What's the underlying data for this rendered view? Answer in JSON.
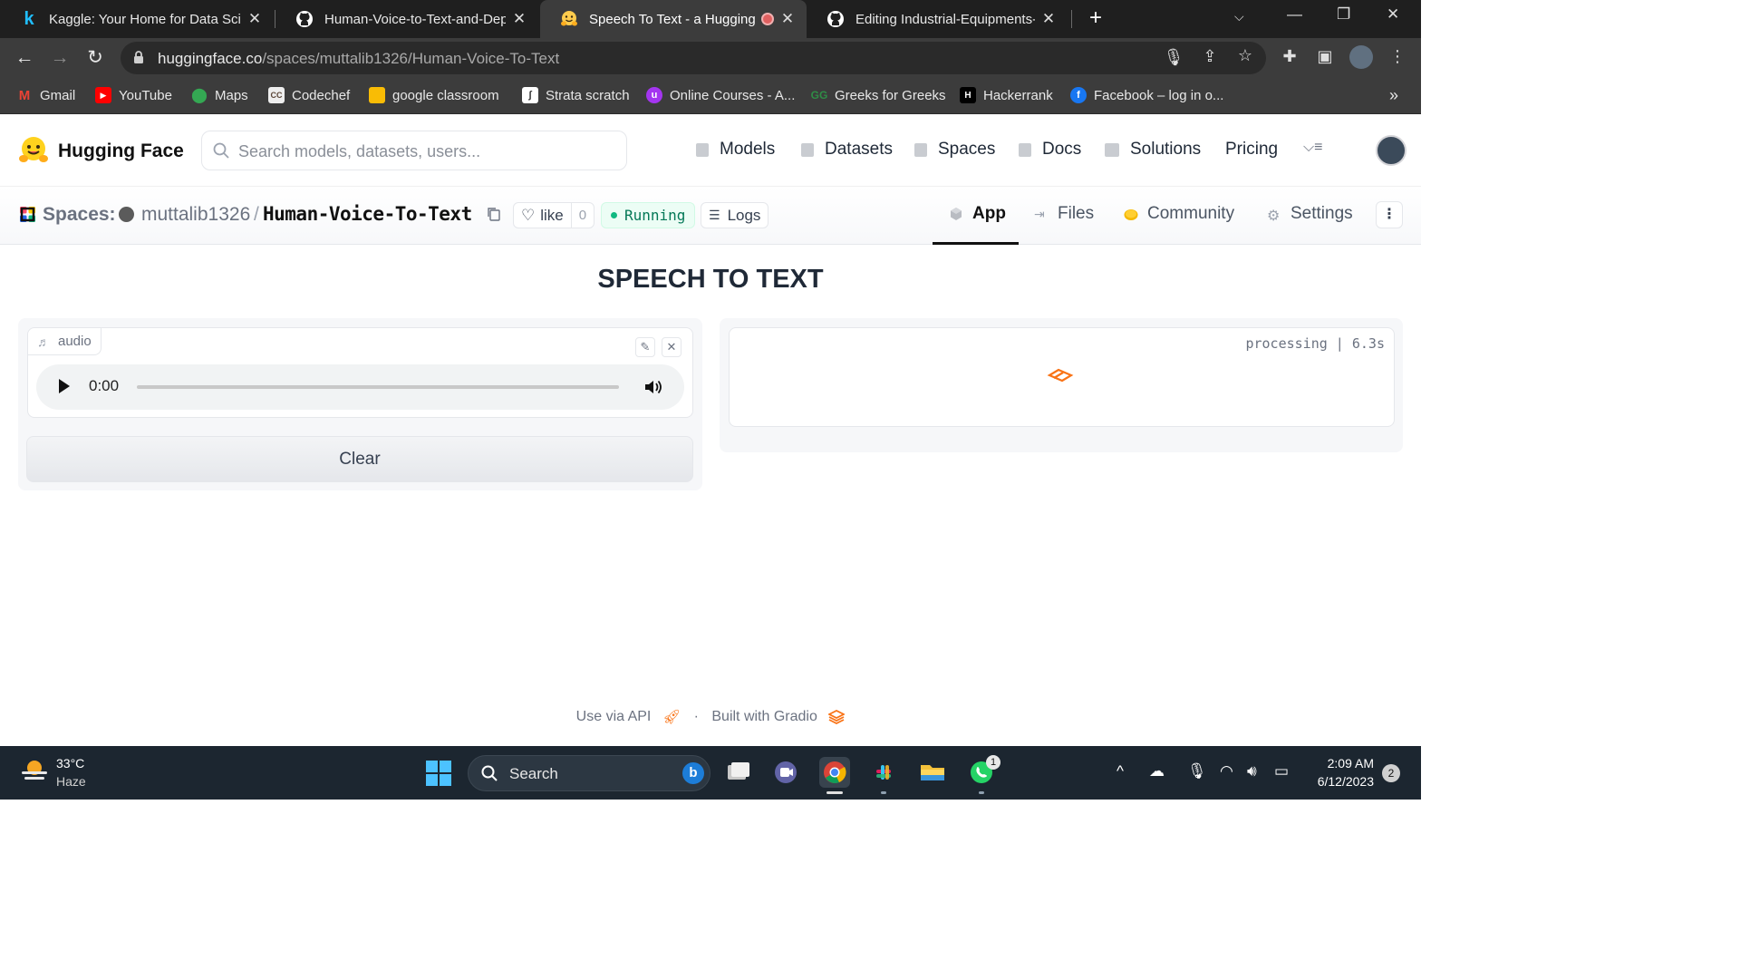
{
  "browser": {
    "tabs": [
      {
        "title": "Kaggle: Your Home for Data Science",
        "icon": "kaggle-icon"
      },
      {
        "title": "Human-Voice-to-Text-and-Deployment",
        "icon": "github-icon"
      },
      {
        "title": "Speech To Text - a Hugging Face Space",
        "icon": "hugging-face-icon"
      },
      {
        "title": "Editing Industrial-Equipments-Defect",
        "icon": "github-icon"
      }
    ],
    "url_host": "huggingface.co",
    "url_path": "/spaces/muttalib1326/Human-Voice-To-Text",
    "bookmarks": [
      "Gmail",
      "YouTube",
      "Maps",
      "Codechef",
      "google classroom",
      "Strata scratch",
      "Online Courses - A...",
      "Greeks for Greeks",
      "Hackerrank",
      "Facebook – log in o..."
    ],
    "bookmarks_more": "»"
  },
  "hf": {
    "brand": "Hugging Face",
    "search_placeholder": "Search models, datasets, users...",
    "nav": [
      "Models",
      "Datasets",
      "Spaces",
      "Docs",
      "Solutions",
      "Pricing"
    ]
  },
  "space": {
    "label": "Spaces:",
    "owner": "muttalib1326",
    "slash": "/",
    "name": "Human-Voice-To-Text",
    "like_label": "like",
    "like_count": "0",
    "status": "Running",
    "logs_label": "Logs",
    "tabs": [
      "App",
      "Files",
      "Community",
      "Settings"
    ]
  },
  "app": {
    "title": "SPEECH TO TEXT",
    "audio_label": "audio",
    "audio_time": "0:00",
    "clear_label": "Clear",
    "processing": "processing | 6.3s"
  },
  "footer": {
    "api": "Use via API",
    "separator": "·",
    "built": "Built with Gradio"
  },
  "taskbar": {
    "temp": "33°C",
    "weather": "Haze",
    "search": "Search",
    "time": "2:09 AM",
    "date": "6/12/2023",
    "notifications": "2",
    "whatsapp_badge": "1"
  }
}
